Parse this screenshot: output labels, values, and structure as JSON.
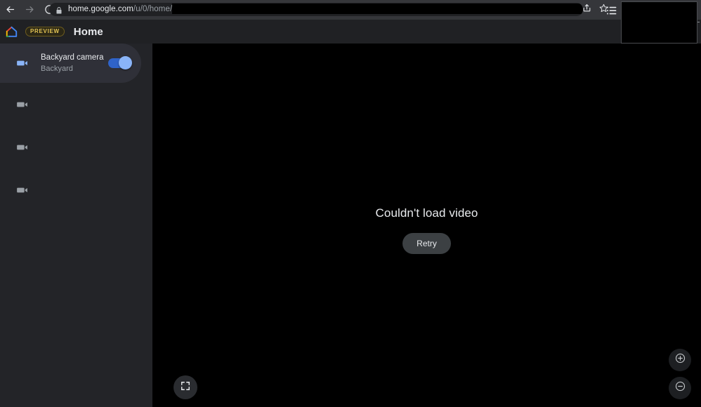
{
  "browser": {
    "back_icon": "arrow-left-icon",
    "forward_icon": "arrow-right-icon",
    "reload_icon": "reload-icon",
    "lock_icon": "lock-icon",
    "url_domain": "home.google.com",
    "url_path": "/u/0/home/",
    "share_icon": "share-icon",
    "bookmark_icon": "star-icon"
  },
  "app_header": {
    "logo_icon": "google-home-logo-icon",
    "badge": "PREVIEW",
    "title": "Home",
    "menu_icon": "list-view-icon"
  },
  "sidebar": {
    "devices": [
      {
        "name": "Backyard camera",
        "room": "Backyard",
        "icon": "videocam-icon",
        "selected": true,
        "toggle_on": true
      },
      {
        "icon": "videocam-icon",
        "selected": false
      },
      {
        "icon": "videocam-icon",
        "selected": false
      },
      {
        "icon": "videocam-icon",
        "selected": false
      }
    ]
  },
  "video": {
    "error_message": "Couldn't load video",
    "retry_label": "Retry",
    "fullscreen_icon": "fullscreen-icon",
    "zoom_in_icon": "zoom-in-icon",
    "zoom_out_icon": "zoom-out-icon"
  },
  "colors": {
    "browser_bar": "#35363a",
    "omnibox": "#202124",
    "app_header": "#202124",
    "sidebar": "#232428",
    "sidebar_selected": "#2f3038",
    "video_background": "#000000",
    "accent_blue": "#8ab4f8",
    "toggle_track": "#2f63c9",
    "badge_gold": "#e3c454",
    "retry_button": "#3c4043",
    "text_primary": "#e8eaed",
    "text_secondary": "#9aa0a6"
  }
}
